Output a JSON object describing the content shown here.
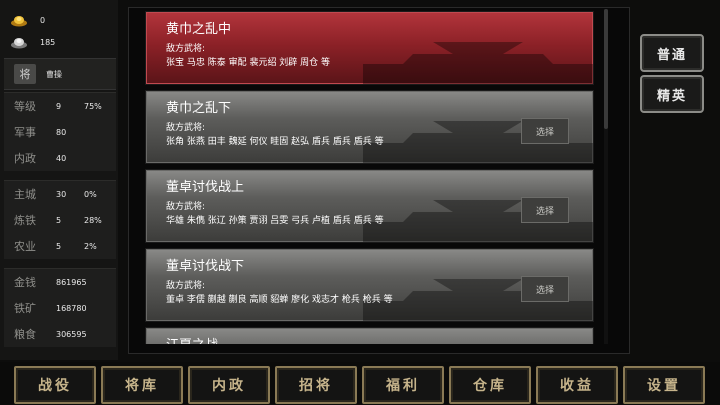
{
  "resources": {
    "gold": "0",
    "silver": "185"
  },
  "general": {
    "name": "曹操"
  },
  "stats_a": [
    {
      "label": "等级",
      "v1": "9",
      "v2": "75%"
    },
    {
      "label": "军事",
      "v1": "80",
      "v2": ""
    },
    {
      "label": "内政",
      "v1": "40",
      "v2": ""
    }
  ],
  "stats_b": [
    {
      "label": "主城",
      "v1": "30",
      "v2": "0%"
    },
    {
      "label": "炼铁",
      "v1": "5",
      "v2": "28%"
    },
    {
      "label": "农业",
      "v1": "5",
      "v2": "2%"
    }
  ],
  "stats_c": [
    {
      "label": "金钱",
      "v1": "861965"
    },
    {
      "label": "铁矿",
      "v1": "168780"
    },
    {
      "label": "粮食",
      "v1": "306595"
    }
  ],
  "battles": [
    {
      "name": "黄巾之乱中",
      "enemy_label": "敌方武将:",
      "generals": "张宝 马忠 陈泰 审配 裴元绍 刘辟 周仓 等",
      "choose": ""
    },
    {
      "name": "黄巾之乱下",
      "enemy_label": "敌方武将:",
      "generals": "张角 张燕 田丰 魏延 何仪 眭固 赵弘 盾兵 盾兵 盾兵 等",
      "choose": "选择"
    },
    {
      "name": "董卓讨伐战上",
      "enemy_label": "敌方武将:",
      "generals": "华雄 朱儁 张辽 孙策 贾诩 吕雯 弓兵 卢植 盾兵 盾兵 等",
      "choose": "选择"
    },
    {
      "name": "董卓讨伐战下",
      "enemy_label": "敌方武将:",
      "generals": "董卓 李儒 蒯越 蒯良 高顺 貂蝉 廖化 戏志才 枪兵 枪兵 等",
      "choose": "选择"
    },
    {
      "name": "江夏之战",
      "enemy_label": "",
      "generals": "",
      "choose": ""
    }
  ],
  "difficulty": {
    "normal": "普通",
    "elite": "精英"
  },
  "tabs": [
    "战役",
    "将库",
    "内政",
    "招将",
    "福利",
    "仓库",
    "收益",
    "设置"
  ],
  "colors": {
    "selected": "#8c2127",
    "tab_border": "#8a7a55",
    "tab_text": "#c6b48b"
  }
}
